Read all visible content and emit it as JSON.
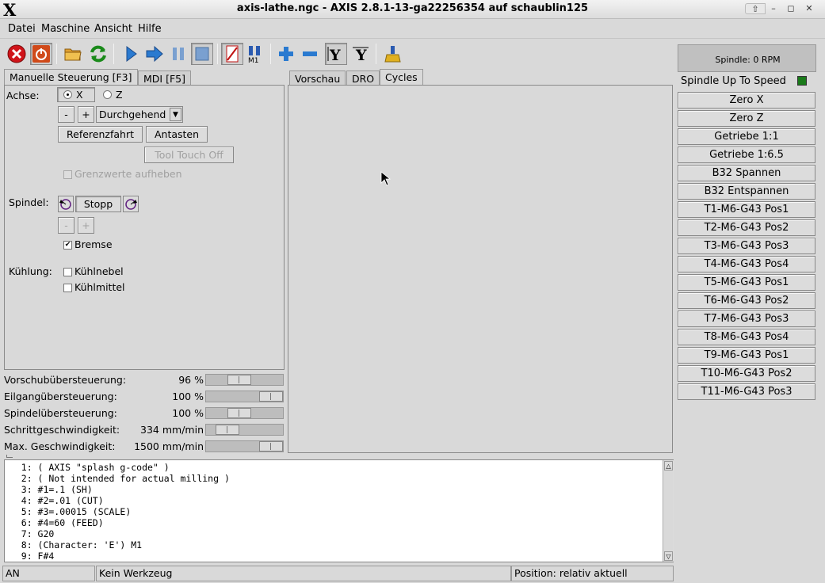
{
  "window": {
    "title": "axis-lathe.ngc - AXIS 2.8.1-13-ga22256354 auf  schaublin125",
    "logo": "X"
  },
  "menu": [
    "Datei",
    "Maschine",
    "Ansicht",
    "Hilfe"
  ],
  "toolbar_icons": [
    "estop-icon",
    "power-icon",
    "open-file-icon",
    "reload-icon",
    "run-icon",
    "step-icon",
    "pause-icon",
    "stop-icon",
    "block-delete-icon",
    "optional-stop-icon",
    "zoom-in-icon",
    "zoom-out-icon",
    "view-y-icon",
    "view-y2-icon",
    "clear-plot-icon"
  ],
  "left_tabs": [
    "Manuelle Steuerung [F3]",
    "MDI [F5]"
  ],
  "manual": {
    "axis_label": "Achse:",
    "axis_x": "X",
    "axis_z": "Z",
    "axis_selected": "X",
    "jog_minus": "-",
    "jog_plus": "+",
    "jog_mode": "Durchgehend",
    "home_button": "Referenzfahrt",
    "touch_button": "Antasten",
    "tool_touch_button": "Tool Touch Off",
    "override_limits": "Grenzwerte aufheben",
    "spindle_label": "Spindel:",
    "spindle_stop": "Stopp",
    "spindle_minus": "-",
    "spindle_plus": "+",
    "brake": "Bremse",
    "brake_checked": true,
    "coolant_label": "Kühlung:",
    "mist": "Kühlnebel",
    "flood": "Kühlmittel"
  },
  "overrides": [
    {
      "label": "Vorschubübersteuerung:",
      "value": "96 %",
      "fraction": 0.4
    },
    {
      "label": "Eilgangübersteuerung:",
      "value": "100 %",
      "fraction": 1.0
    },
    {
      "label": "Spindelübersteuerung:",
      "value": "100 %",
      "fraction": 0.4
    },
    {
      "label": "Schrittgeschwindigkeit:",
      "value": "334 mm/min",
      "fraction": 0.18
    },
    {
      "label": "Max. Geschwindigkeit:",
      "value": "1500 mm/min",
      "fraction": 1.0
    }
  ],
  "preview_tabs": [
    "Vorschau",
    "DRO",
    "Cycles"
  ],
  "preview_active_tab": "Cycles",
  "gcode": [
    "   1: ( AXIS \"splash g-code\" )",
    "   2: ( Not intended for actual milling )",
    "   3: #1=.1 (SH)",
    "   4: #2=.01 (CUT)",
    "   5: #3=.00015 (SCALE)",
    "   6: #4=60 (FEED)",
    "   7: G20",
    "   8: (Character: 'E') M1",
    "   9: F#4"
  ],
  "status": {
    "state": "AN",
    "tool": "Kein Werkzeug",
    "position": "Position: relativ aktuell"
  },
  "right": {
    "spindle_rpm": "Spindle:    0 RPM",
    "spindle_up": "Spindle Up To Speed",
    "led_color": "#1a7a1a",
    "buttons": [
      "Zero X",
      "Zero Z",
      "Getriebe 1:1",
      "Getriebe 1:6.5",
      "B32 Spannen",
      "B32 Entspannen",
      "T1-M6-G43 Pos1",
      "T2-M6-G43 Pos2",
      "T3-M6-G43 Pos3",
      "T4-M6-G43 Pos4",
      "T5-M6-G43 Pos1",
      "T6-M6-G43 Pos2",
      "T7-M6-G43 Pos3",
      "T8-M6-G43 Pos4",
      "T9-M6-G43 Pos1",
      "T10-M6-G43 Pos2",
      "T11-M6-G43 Pos3"
    ]
  }
}
